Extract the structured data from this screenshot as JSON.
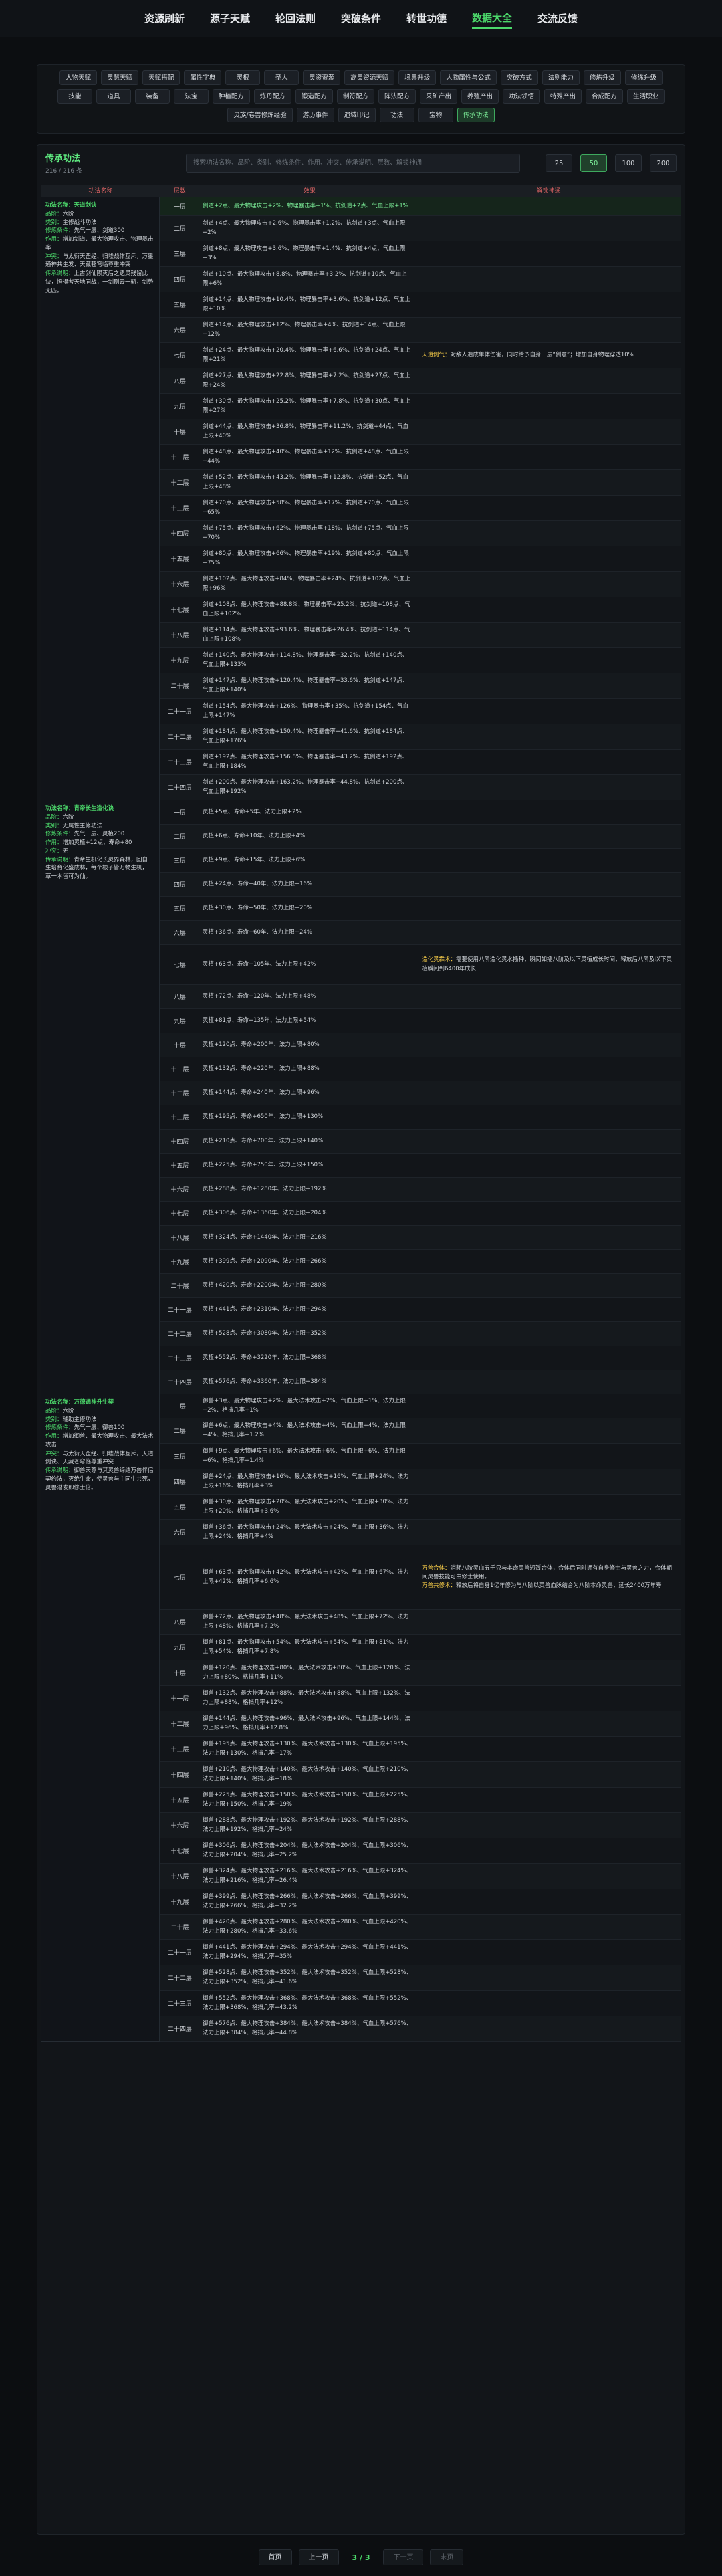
{
  "nav": [
    "资源刷新",
    "源子天赋",
    "轮回法则",
    "突破条件",
    "转世功德",
    "数据大全",
    "交流反馈"
  ],
  "nav_active": 5,
  "categories": [
    "人物天赋",
    "灵慧天赋",
    "天赋搭配",
    "属性字典",
    "灵根",
    "圣人",
    "灵资资源",
    "高灵资源天赋",
    "境界升级",
    "人物属性与公式",
    "突破方式",
    "法则能力",
    "修炼升级",
    "修练升级",
    "技能",
    "道具",
    "装备",
    "法宝",
    "种植配方",
    "炼丹配方",
    "锻造配方",
    "制符配方",
    "阵法配方",
    "采矿产出",
    "养殖产出",
    "功法领悟",
    "特殊产出",
    "合成配方",
    "生活职业",
    "灵族/卷兽修炼经验",
    "游历事件",
    "遗域印记",
    "功法",
    "宝物",
    "传承功法"
  ],
  "category_active": 34,
  "panel": {
    "title": "传承功法",
    "count": "216 / 216 条",
    "search_placeholder": "搜索功法名称、品阶、类别、修炼条件、作用、冲突、传承说明、层数、解锁神通",
    "page_sizes": [
      "25",
      "50",
      "100",
      "200"
    ],
    "page_size_active": 1
  },
  "table_headers": [
    "功法名称",
    "层数",
    "效果",
    "解锁神通"
  ],
  "groups": [
    {
      "lines": [
        {
          "k": "功法名称：",
          "v": "天道剑诀"
        },
        {
          "k": "品阶：",
          "v": "六阶"
        },
        {
          "k": "类别：",
          "v": "主修战斗功法"
        },
        {
          "k": "修炼条件：",
          "v": "先气一层、剑道300"
        },
        {
          "k": "作用：",
          "v": "增加剑道、最大物理攻击、物理暴击率"
        },
        {
          "k": "冲突：",
          "v": "与太衍天罡经、归墟战体互斥，万墨通神共生发、天藏苍穹临尊重冲突"
        },
        {
          "k": "传承说明：",
          "v": "上古剑仙陨灭后之遗灵残留此诀，悟得者天地同战，一剑刷云一斩，剑势无匹。"
        }
      ],
      "rows": [
        {
          "lv": "一层",
          "ef": "剑道+2点、最大物理攻击+2%、物理暴击率+1%、抗剑道+2点、气血上限+1%",
          "nt": "",
          "hl": true
        },
        {
          "lv": "二层",
          "ef": "剑道+4点、最大物理攻击+2.6%、物理暴击率+1.2%、抗剑道+3点、气血上限+2%",
          "nt": ""
        },
        {
          "lv": "三层",
          "ef": "剑道+8点、最大物理攻击+3.6%、物理暴击率+1.4%、抗剑道+4点、气血上限+3%",
          "nt": ""
        },
        {
          "lv": "四层",
          "ef": "剑道+10点、最大物理攻击+8.8%、物理暴击率+3.2%、抗剑道+10点、气血上限+6%",
          "nt": ""
        },
        {
          "lv": "五层",
          "ef": "剑道+14点、最大物理攻击+10.4%、物理暴击率+3.6%、抗剑道+12点、气血上限+10%",
          "nt": ""
        },
        {
          "lv": "六层",
          "ef": "剑道+14点、最大物理攻击+12%、物理暴击率+4%、抗剑道+14点、气血上限+12%",
          "nt": ""
        },
        {
          "lv": "七层",
          "ef": "剑道+24点、最大物理攻击+20.4%、物理暴击率+6.6%、抗剑道+24点、气血上限+21%",
          "nt": "<b>天道剑气：</b>对敌人造成单体伤害，同时给予自身一层“剑意”；增加自身物理穿透10%"
        },
        {
          "lv": "八层",
          "ef": "剑道+27点、最大物理攻击+22.8%、物理暴击率+7.2%、抗剑道+27点、气血上限+24%",
          "nt": ""
        },
        {
          "lv": "九层",
          "ef": "剑道+30点、最大物理攻击+25.2%、物理暴击率+7.8%、抗剑道+30点、气血上限+27%",
          "nt": ""
        },
        {
          "lv": "十层",
          "ef": "剑道+44点、最大物理攻击+36.8%、物理暴击率+11.2%、抗剑道+44点、气血上限+40%",
          "nt": ""
        },
        {
          "lv": "十一层",
          "ef": "剑道+48点、最大物理攻击+40%、物理暴击率+12%、抗剑道+48点、气血上限+44%",
          "nt": ""
        },
        {
          "lv": "十二层",
          "ef": "剑道+52点、最大物理攻击+43.2%、物理暴击率+12.8%、抗剑道+52点、气血上限+48%",
          "nt": ""
        },
        {
          "lv": "十三层",
          "ef": "剑道+70点、最大物理攻击+58%、物理暴击率+17%、抗剑道+70点、气血上限+65%",
          "nt": ""
        },
        {
          "lv": "十四层",
          "ef": "剑道+75点、最大物理攻击+62%、物理暴击率+18%、抗剑道+75点、气血上限+70%",
          "nt": ""
        },
        {
          "lv": "十五层",
          "ef": "剑道+80点、最大物理攻击+66%、物理暴击率+19%、抗剑道+80点、气血上限+75%",
          "nt": ""
        },
        {
          "lv": "十六层",
          "ef": "剑道+102点、最大物理攻击+84%、物理暴击率+24%、抗剑道+102点、气血上限+96%",
          "nt": ""
        },
        {
          "lv": "十七层",
          "ef": "剑道+108点、最大物理攻击+88.8%、物理暴击率+25.2%、抗剑道+108点、气血上限+102%",
          "nt": ""
        },
        {
          "lv": "十八层",
          "ef": "剑道+114点、最大物理攻击+93.6%、物理暴击率+26.4%、抗剑道+114点、气血上限+108%",
          "nt": ""
        },
        {
          "lv": "十九层",
          "ef": "剑道+140点、最大物理攻击+114.8%、物理暴击率+32.2%、抗剑道+140点、气血上限+133%",
          "nt": ""
        },
        {
          "lv": "二十层",
          "ef": "剑道+147点、最大物理攻击+120.4%、物理暴击率+33.6%、抗剑道+147点、气血上限+140%",
          "nt": ""
        },
        {
          "lv": "二十一层",
          "ef": "剑道+154点、最大物理攻击+126%、物理暴击率+35%、抗剑道+154点、气血上限+147%",
          "nt": ""
        },
        {
          "lv": "二十二层",
          "ef": "剑道+184点、最大物理攻击+150.4%、物理暴击率+41.6%、抗剑道+184点、气血上限+176%",
          "nt": ""
        },
        {
          "lv": "二十三层",
          "ef": "剑道+192点、最大物理攻击+156.8%、物理暴击率+43.2%、抗剑道+192点、气血上限+184%",
          "nt": ""
        },
        {
          "lv": "二十四层",
          "ef": "剑道+200点、最大物理攻击+163.2%、物理暴击率+44.8%、抗剑道+200点、气血上限+192%",
          "nt": ""
        }
      ]
    },
    {
      "lines": [
        {
          "k": "功法名称：",
          "v": "青帝长生造化诀"
        },
        {
          "k": "品阶：",
          "v": "六阶"
        },
        {
          "k": "类别：",
          "v": "无属性主修功法"
        },
        {
          "k": "修炼条件：",
          "v": "先气一层、灵植200"
        },
        {
          "k": "作用：",
          "v": "增加灵植+12点、寿命+80"
        },
        {
          "k": "冲突：",
          "v": "无"
        },
        {
          "k": "传承说明：",
          "v": "青帝生机化长灵界森林，回自一生培育化盛成林，每个根子皆万物生机，一草一木皆可为仙。"
        }
      ],
      "rows": [
        {
          "lv": "一层",
          "ef": "灵植+5点、寿命+5年、法力上限+2%",
          "nt": ""
        },
        {
          "lv": "二层",
          "ef": "灵植+6点、寿命+10年、法力上限+4%",
          "nt": ""
        },
        {
          "lv": "三层",
          "ef": "灵植+9点、寿命+15年、法力上限+6%",
          "nt": ""
        },
        {
          "lv": "四层",
          "ef": "灵植+24点、寿命+40年、法力上限+16%",
          "nt": ""
        },
        {
          "lv": "五层",
          "ef": "灵植+30点、寿命+50年、法力上限+20%",
          "nt": ""
        },
        {
          "lv": "六层",
          "ef": "灵植+36点、寿命+60年、法力上限+24%",
          "nt": ""
        },
        {
          "lv": "七层",
          "ef": "灵植+63点、寿命+105年、法力上限+42%",
          "nt": "<b>造化灵霖术：</b>需要使用八阶造化灵水播种，瞬间如播八阶及以下灵植成长时间，释放后八阶及以下灵植瞬间到6400年成长"
        },
        {
          "lv": "八层",
          "ef": "灵植+72点、寿命+120年、法力上限+48%",
          "nt": ""
        },
        {
          "lv": "九层",
          "ef": "灵植+81点、寿命+135年、法力上限+54%",
          "nt": ""
        },
        {
          "lv": "十层",
          "ef": "灵植+120点、寿命+200年、法力上限+80%",
          "nt": ""
        },
        {
          "lv": "十一层",
          "ef": "灵植+132点、寿命+220年、法力上限+88%",
          "nt": ""
        },
        {
          "lv": "十二层",
          "ef": "灵植+144点、寿命+240年、法力上限+96%",
          "nt": ""
        },
        {
          "lv": "十三层",
          "ef": "灵植+195点、寿命+650年、法力上限+130%",
          "nt": ""
        },
        {
          "lv": "十四层",
          "ef": "灵植+210点、寿命+700年、法力上限+140%",
          "nt": ""
        },
        {
          "lv": "十五层",
          "ef": "灵植+225点、寿命+750年、法力上限+150%",
          "nt": ""
        },
        {
          "lv": "十六层",
          "ef": "灵植+288点、寿命+1280年、法力上限+192%",
          "nt": ""
        },
        {
          "lv": "十七层",
          "ef": "灵植+306点、寿命+1360年、法力上限+204%",
          "nt": ""
        },
        {
          "lv": "十八层",
          "ef": "灵植+324点、寿命+1440年、法力上限+216%",
          "nt": ""
        },
        {
          "lv": "十九层",
          "ef": "灵植+399点、寿命+2090年、法力上限+266%",
          "nt": ""
        },
        {
          "lv": "二十层",
          "ef": "灵植+420点、寿命+2200年、法力上限+280%",
          "nt": ""
        },
        {
          "lv": "二十一层",
          "ef": "灵植+441点、寿命+2310年、法力上限+294%",
          "nt": ""
        },
        {
          "lv": "二十二层",
          "ef": "灵植+528点、寿命+3080年、法力上限+352%",
          "nt": ""
        },
        {
          "lv": "二十三层",
          "ef": "灵植+552点、寿命+3220年、法力上限+368%",
          "nt": ""
        },
        {
          "lv": "二十四层",
          "ef": "灵植+576点、寿命+3360年、法力上限+384%",
          "nt": ""
        }
      ]
    },
    {
      "lines": [
        {
          "k": "功法名称：",
          "v": "万德通神升生契"
        },
        {
          "k": "品阶：",
          "v": "六阶"
        },
        {
          "k": "类别：",
          "v": "辅助主修功法"
        },
        {
          "k": "修炼条件：",
          "v": "先气一层、御兽100"
        },
        {
          "k": "作用：",
          "v": "增加御兽、最大物理攻击、最大法术攻击"
        },
        {
          "k": "冲突：",
          "v": "与太衍天罡经、归墟战体互斥，天道剑诀、天藏苍穹临尊重冲突"
        },
        {
          "k": "传承说明：",
          "v": "御兽天尊与其灵兽缔结万兽伴侣契约法，灭绝生命，使灵兽与主同生共死，灵兽潜发即修士倍。"
        }
      ],
      "rows": [
        {
          "lv": "一层",
          "ef": "御兽+3点、最大物理攻击+2%、最大法术攻击+2%、气血上限+1%、法力上限+2%、格挡几率+1%",
          "nt": ""
        },
        {
          "lv": "二层",
          "ef": "御兽+6点、最大物理攻击+4%、最大法术攻击+4%、气血上限+4%、法力上限+4%、格挡几率+1.2%",
          "nt": ""
        },
        {
          "lv": "三层",
          "ef": "御兽+9点、最大物理攻击+6%、最大法术攻击+6%、气血上限+6%、法力上限+6%、格挡几率+1.4%",
          "nt": ""
        },
        {
          "lv": "四层",
          "ef": "御兽+24点、最大物理攻击+16%、最大法术攻击+16%、气血上限+24%、法力上限+16%、格挡几率+3%",
          "nt": ""
        },
        {
          "lv": "五层",
          "ef": "御兽+30点、最大物理攻击+20%、最大法术攻击+20%、气血上限+30%、法力上限+20%、格挡几率+3.6%",
          "nt": ""
        },
        {
          "lv": "六层",
          "ef": "御兽+36点、最大物理攻击+24%、最大法术攻击+24%、气血上限+36%、法力上限+24%、格挡几率+4%",
          "nt": ""
        },
        {
          "lv": "七层",
          "ef": "御兽+63点、最大物理攻击+42%、最大法术攻击+42%、气血上限+67%、法力上限+42%、格挡几率+6.6%",
          "nt": "<b>万兽合体：</b>消耗八阶灵血五千只与本命灵兽短暂合体，合体后同时拥有自身修士与灵兽之力，合体期间灵兽技能可由修士使用。<br><b>万兽共修术：</b>释放后将自身1亿年修为与八阶以灵兽血脉结合为八阶本命灵兽，延长2400万年寿"
        },
        {
          "lv": "八层",
          "ef": "御兽+72点、最大物理攻击+48%、最大法术攻击+48%、气血上限+72%、法力上限+48%、格挡几率+7.2%",
          "nt": ""
        },
        {
          "lv": "九层",
          "ef": "御兽+81点、最大物理攻击+54%、最大法术攻击+54%、气血上限+81%、法力上限+54%、格挡几率+7.8%",
          "nt": ""
        },
        {
          "lv": "十层",
          "ef": "御兽+120点、最大物理攻击+80%、最大法术攻击+80%、气血上限+120%、法力上限+80%、格挡几率+11%",
          "nt": ""
        },
        {
          "lv": "十一层",
          "ef": "御兽+132点、最大物理攻击+88%、最大法术攻击+88%、气血上限+132%、法力上限+88%、格挡几率+12%",
          "nt": ""
        },
        {
          "lv": "十二层",
          "ef": "御兽+144点、最大物理攻击+96%、最大法术攻击+96%、气血上限+144%、法力上限+96%、格挡几率+12.8%",
          "nt": ""
        },
        {
          "lv": "十三层",
          "ef": "御兽+195点、最大物理攻击+130%、最大法术攻击+130%、气血上限+195%、法力上限+130%、格挡几率+17%",
          "nt": ""
        },
        {
          "lv": "十四层",
          "ef": "御兽+210点、最大物理攻击+140%、最大法术攻击+140%、气血上限+210%、法力上限+140%、格挡几率+18%",
          "nt": ""
        },
        {
          "lv": "十五层",
          "ef": "御兽+225点、最大物理攻击+150%、最大法术攻击+150%、气血上限+225%、法力上限+150%、格挡几率+19%",
          "nt": ""
        },
        {
          "lv": "十六层",
          "ef": "御兽+288点、最大物理攻击+192%、最大法术攻击+192%、气血上限+288%、法力上限+192%、格挡几率+24%",
          "nt": ""
        },
        {
          "lv": "十七层",
          "ef": "御兽+306点、最大物理攻击+204%、最大法术攻击+204%、气血上限+306%、法力上限+204%、格挡几率+25.2%",
          "nt": ""
        },
        {
          "lv": "十八层",
          "ef": "御兽+324点、最大物理攻击+216%、最大法术攻击+216%、气血上限+324%、法力上限+216%、格挡几率+26.4%",
          "nt": ""
        },
        {
          "lv": "十九层",
          "ef": "御兽+399点、最大物理攻击+266%、最大法术攻击+266%、气血上限+399%、法力上限+266%、格挡几率+32.2%",
          "nt": ""
        },
        {
          "lv": "二十层",
          "ef": "御兽+420点、最大物理攻击+280%、最大法术攻击+280%、气血上限+420%、法力上限+280%、格挡几率+33.6%",
          "nt": ""
        },
        {
          "lv": "二十一层",
          "ef": "御兽+441点、最大物理攻击+294%、最大法术攻击+294%、气血上限+441%、法力上限+294%、格挡几率+35%",
          "nt": ""
        },
        {
          "lv": "二十二层",
          "ef": "御兽+528点、最大物理攻击+352%、最大法术攻击+352%、气血上限+528%、法力上限+352%、格挡几率+41.6%",
          "nt": ""
        },
        {
          "lv": "二十三层",
          "ef": "御兽+552点、最大物理攻击+368%、最大法术攻击+368%、气血上限+552%、法力上限+368%、格挡几率+43.2%",
          "nt": ""
        },
        {
          "lv": "二十四层",
          "ef": "御兽+576点、最大物理攻击+384%、最大法术攻击+384%、气血上限+576%、法力上限+384%、格挡几率+44.8%",
          "nt": ""
        }
      ]
    }
  ],
  "pager": {
    "first": "首页",
    "prev": "上一页",
    "info": "3 / 3",
    "next": "下一页",
    "last": "末页"
  }
}
